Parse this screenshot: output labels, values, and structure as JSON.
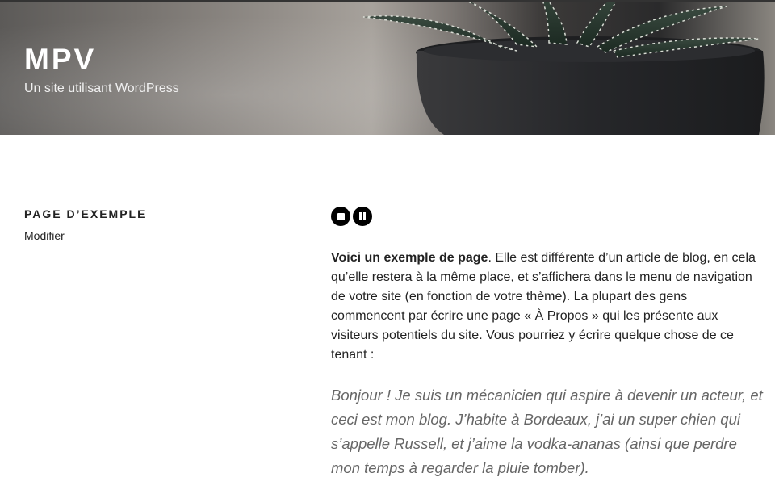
{
  "header": {
    "site_title": "MPV",
    "site_description": "Un site utilisant WordPress"
  },
  "sidebar": {
    "page_title": "PAGE D’EXEMPLE",
    "edit_link": "Modifier"
  },
  "media_controls": {
    "stop_icon": "stop-icon",
    "pause_icon": "pause-icon"
  },
  "content": {
    "intro_bold": "Voici un exemple de page",
    "paragraph": ". Elle est différente d’un article de blog, en cela qu’elle restera à la même place, et s’affichera dans le menu de navigation de votre site (en fonction de votre thème). La plupart des gens commencent par écrire une page « À Propos » qui les présente aux visiteurs potentiels du site. Vous pourriez y écrire quelque chose de ce tenant :",
    "quote": "Bonjour ! Je suis un mécanicien qui aspire à devenir un acteur, et ceci est mon blog. J’habite à Bordeaux, j’ai un super chien qui s’appelle Russell, et j’aime la vodka-ananas (ainsi que perdre mon temps à regarder la pluie tomber)."
  }
}
